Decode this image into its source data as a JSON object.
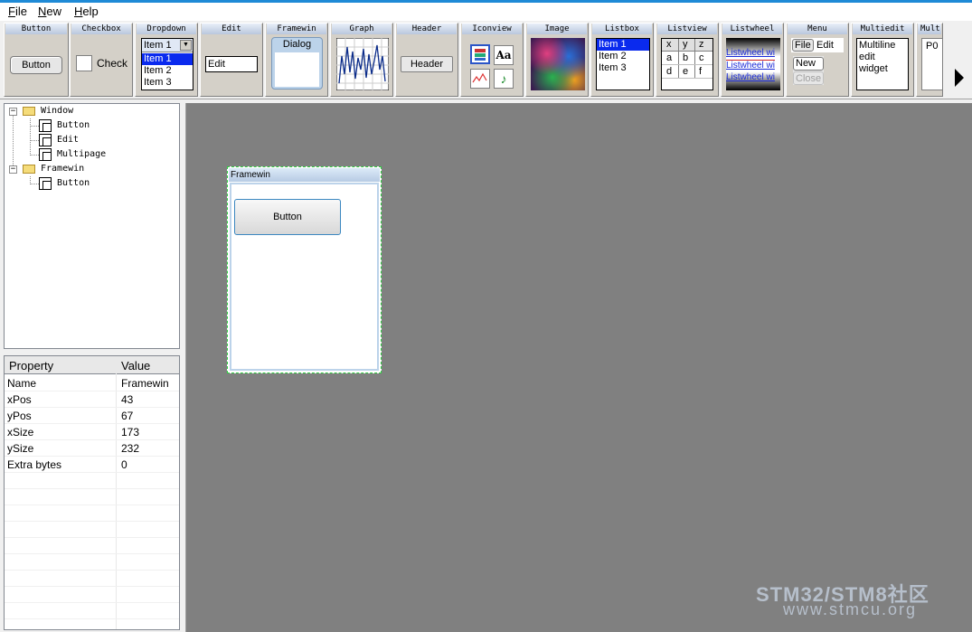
{
  "menu": {
    "file": "File",
    "new": "New",
    "help": "Help"
  },
  "palette": {
    "button": {
      "title": "Button",
      "label": "Button"
    },
    "checkbox": {
      "title": "Checkbox",
      "label": "Check"
    },
    "dropdown": {
      "title": "Dropdown",
      "selected": "Item 1",
      "items": [
        "Item 1",
        "Item 2",
        "Item 3"
      ]
    },
    "edit": {
      "title": "Edit",
      "value": "Edit"
    },
    "framewin": {
      "title": "Framewin",
      "caption": "Dialog"
    },
    "graph": {
      "title": "Graph"
    },
    "header": {
      "title": "Header",
      "label": "Header"
    },
    "iconview": {
      "title": "Iconview",
      "aa": "Aa"
    },
    "image": {
      "title": "Image"
    },
    "listbox": {
      "title": "Listbox",
      "items": [
        "Item 1",
        "Item 2",
        "Item 3"
      ]
    },
    "listview": {
      "title": "Listview",
      "headers": [
        "x",
        "y",
        "z"
      ],
      "rows": [
        [
          "a",
          "b",
          "c"
        ],
        [
          "d",
          "e",
          "f"
        ]
      ]
    },
    "listwheel": {
      "title": "Listwheel",
      "items": [
        "Listwheel wi",
        "Listwheel wi",
        "Listwheel wi"
      ]
    },
    "menu": {
      "title": "Menu",
      "file": "File",
      "edit": "Edit",
      "new": "New",
      "close": "Close"
    },
    "multiedit": {
      "title": "Multiedit",
      "lines": [
        "Multiline",
        "edit",
        "widget"
      ]
    },
    "multipage": {
      "title": "Mult",
      "tab": "P0"
    }
  },
  "tree": {
    "window": "Window",
    "button": "Button",
    "edit": "Edit",
    "multipage": "Multipage",
    "framewin": "Framewin",
    "fw_button": "Button"
  },
  "properties": {
    "header_property": "Property",
    "header_value": "Value",
    "rows": [
      {
        "name": "Name",
        "value": "Framewin"
      },
      {
        "name": "xPos",
        "value": "43"
      },
      {
        "name": "yPos",
        "value": "67"
      },
      {
        "name": "xSize",
        "value": "173"
      },
      {
        "name": "ySize",
        "value": "232"
      },
      {
        "name": "Extra bytes",
        "value": "0"
      }
    ]
  },
  "canvas": {
    "framewin_title": "Framewin",
    "button_label": "Button"
  },
  "watermark": {
    "line1": "STM32/STM8社区",
    "line2": "www.stmcu.org"
  }
}
